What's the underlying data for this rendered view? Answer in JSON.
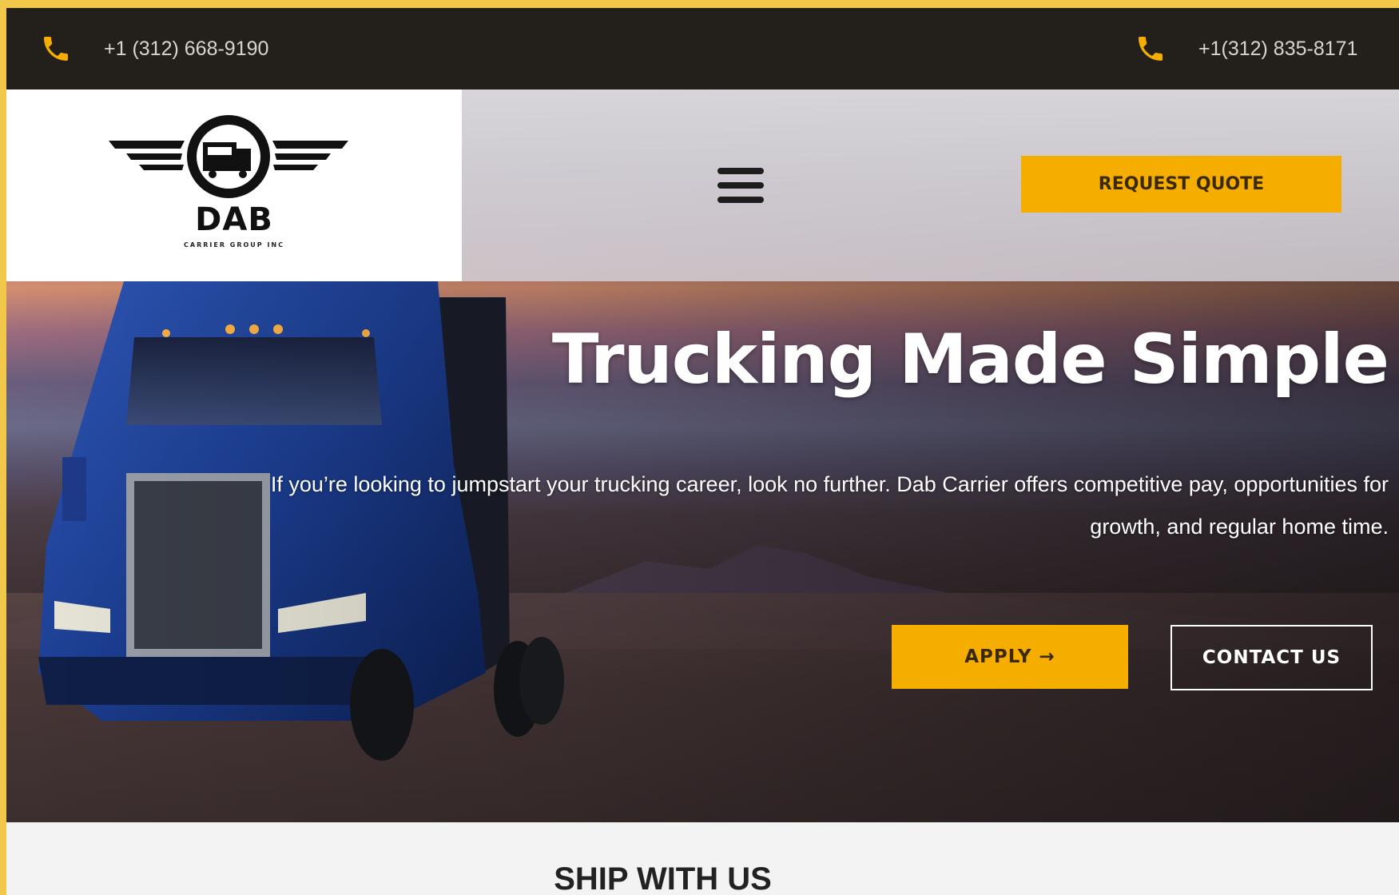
{
  "topbar": {
    "phone_left": "+1 (312) 668-9190",
    "phone_right": "+1(312) 835-8171"
  },
  "header": {
    "logo_name": "DAB",
    "logo_subtitle": "CARRIER GROUP INC",
    "request_quote_label": "REQUEST QUOTE"
  },
  "hero": {
    "title": "Trucking Made Simple",
    "text": "If you’re looking to jumpstart your trucking career, look no further. Dab Carrier offers competitive pay, opportunities for growth, and regular home time.",
    "apply_label": "APPLY →",
    "contact_label": "CONTACT US"
  },
  "section": {
    "title": "SHIP WITH US"
  },
  "colors": {
    "accent": "#f5ad00",
    "topbar_bg": "#23201b"
  }
}
